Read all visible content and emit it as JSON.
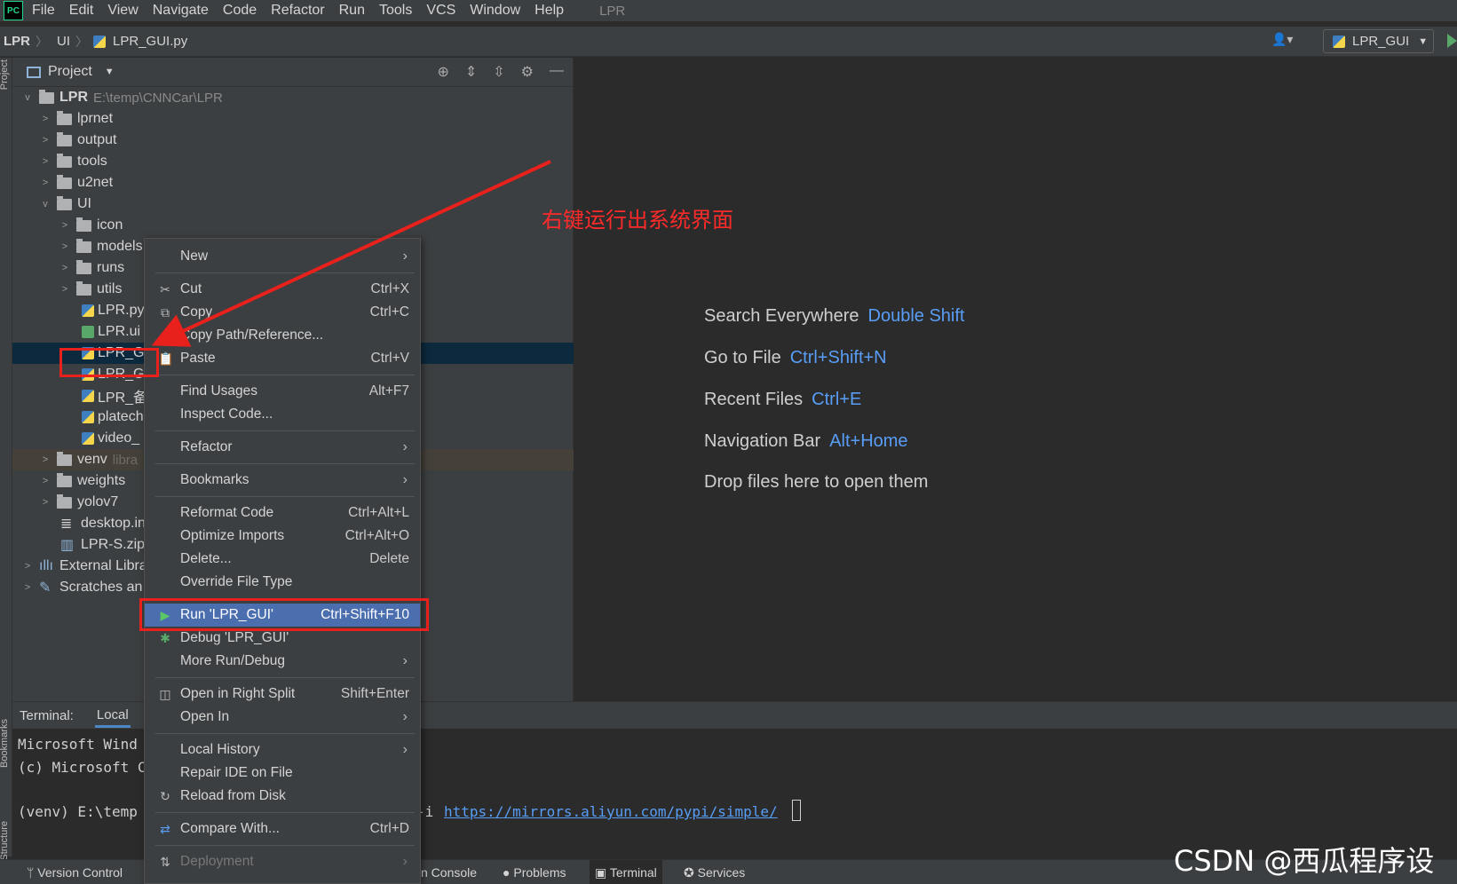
{
  "menubar": {
    "items": [
      "File",
      "Edit",
      "View",
      "Navigate",
      "Code",
      "Refactor",
      "Run",
      "Tools",
      "VCS",
      "Window",
      "Help"
    ],
    "project": "LPR"
  },
  "navbar": {
    "crumbs": [
      "LPR",
      "UI",
      "LPR_GUI.py"
    ],
    "run_config": "LPR_GUI"
  },
  "strip": {
    "project": "Project",
    "bookmarks": "Bookmarks",
    "structure": "Structure"
  },
  "project_panel": {
    "title": "Project",
    "root": {
      "name": "LPR",
      "path": "E:\\temp\\CNNCar\\LPR"
    },
    "rows": [
      "lprnet",
      "output",
      "tools",
      "u2net",
      "UI",
      "icon",
      "models",
      "runs",
      "utils",
      "LPR.py",
      "LPR.ui",
      "LPR_GUI",
      "LPR_GU",
      "LPR_备",
      "platech",
      "video_",
      "venv",
      "weights",
      "yolov7",
      "desktop.ini",
      "LPR-S.zip",
      "External Libra",
      "Scratches an"
    ],
    "venv_hint": "libra"
  },
  "editor_hints": [
    {
      "text": "Search Everywhere",
      "key": "Double Shift"
    },
    {
      "text": "Go to File",
      "key": "Ctrl+Shift+N"
    },
    {
      "text": "Recent Files",
      "key": "Ctrl+E"
    },
    {
      "text": "Navigation Bar",
      "key": "Alt+Home"
    },
    {
      "text": "Drop files here to open them",
      "key": ""
    }
  ],
  "annotation": "右键运行出系统界面",
  "context_menu": {
    "new": "New",
    "cut": "Cut",
    "cut_sc": "Ctrl+X",
    "copy": "Copy",
    "copy_sc": "Ctrl+C",
    "copy_path": "Copy Path/Reference...",
    "paste": "Paste",
    "paste_sc": "Ctrl+V",
    "find_usages": "Find Usages",
    "find_usages_sc": "Alt+F7",
    "inspect": "Inspect Code...",
    "refactor": "Refactor",
    "bookmarks": "Bookmarks",
    "reformat": "Reformat Code",
    "reformat_sc": "Ctrl+Alt+L",
    "optimize": "Optimize Imports",
    "optimize_sc": "Ctrl+Alt+O",
    "delete": "Delete...",
    "delete_sc": "Delete",
    "override": "Override File Type",
    "run": "Run 'LPR_GUI'",
    "run_sc": "Ctrl+Shift+F10",
    "debug": "Debug 'LPR_GUI'",
    "more_run": "More Run/Debug",
    "open_split": "Open in Right Split",
    "open_split_sc": "Shift+Enter",
    "open_in": "Open In",
    "local_history": "Local History",
    "repair": "Repair IDE on File",
    "reload": "Reload from Disk",
    "compare": "Compare With...",
    "compare_sc": "Ctrl+D",
    "deployment": "Deployment"
  },
  "terminal": {
    "label": "Terminal:",
    "tab": "Local",
    "line1": "Microsoft Wind",
    "line2": "(c) Microsoft C",
    "line3": "(venv) E:\\temp",
    "tail": "-i",
    "url": "https://mirrors.aliyun.com/pypi/simple/"
  },
  "statusbar": {
    "version_control": "Version Control",
    "console": "n Console",
    "problems": "Problems",
    "terminal": "Terminal",
    "services": "Services"
  },
  "watermark": "CSDN @西瓜程序设计"
}
